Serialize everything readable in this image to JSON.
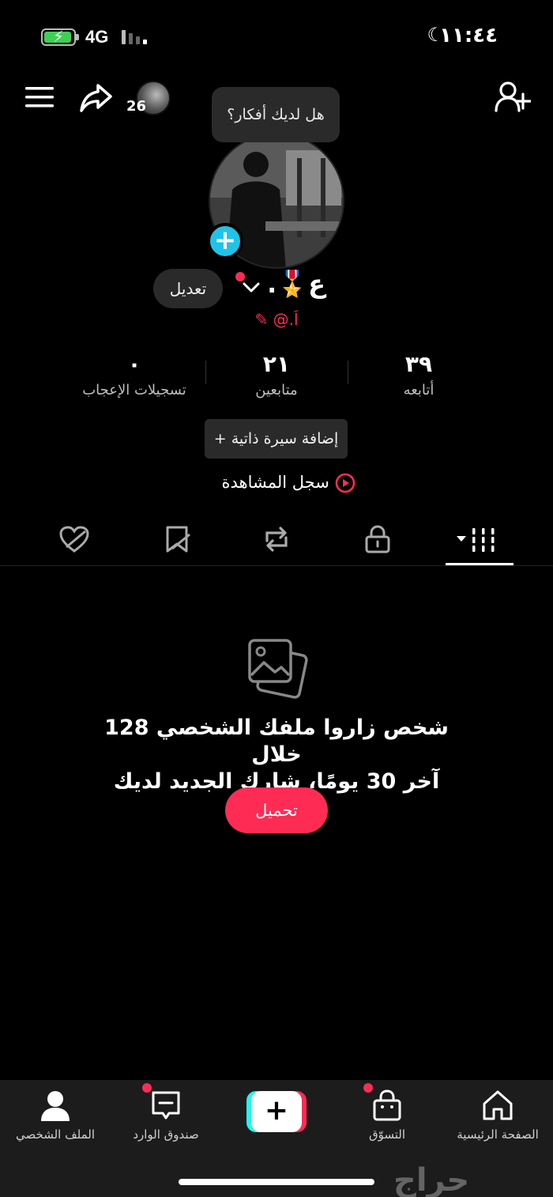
{
  "status_bar": {
    "network": "4G",
    "time": "١١:٤٤",
    "battery_level": 0.85
  },
  "top_bar": {
    "friends_count": "26"
  },
  "tooltip": "هل لديك أفكار؟",
  "profile": {
    "name": "ع🎖️.",
    "handle": "@.اَ",
    "edit_label": "تعديل"
  },
  "stats": [
    {
      "value": "٣٩",
      "label": "أتابعه"
    },
    {
      "value": "٢١",
      "label": "متابعين"
    },
    {
      "value": "٠",
      "label": "تسجيلات الإعجاب"
    }
  ],
  "bio_button": "+ إضافة سيرة ذاتية",
  "watch_history": "سجل المشاهدة",
  "tabs": [
    "videos",
    "private",
    "reposts",
    "favorites",
    "liked"
  ],
  "empty_state": {
    "line1": "128 شخص زاروا ملفك الشخصي خلال",
    "line2": "آخر 30 يومًا، شارك الجديد لديك",
    "upload_label": "تحميل"
  },
  "bottom_nav": [
    {
      "label": "الملف الشخصي",
      "icon": "profile-icon"
    },
    {
      "label": "صندوق الوارد",
      "icon": "inbox-icon"
    },
    {
      "label": "",
      "icon": "create-icon"
    },
    {
      "label": "التسوّق",
      "icon": "shop-icon"
    },
    {
      "label": "الصفحة الرئيسية",
      "icon": "home-icon"
    }
  ],
  "watermark": "حراج",
  "colors": {
    "accent": "#fe2c55",
    "cyan": "#25f4ee",
    "background": "#000000"
  }
}
